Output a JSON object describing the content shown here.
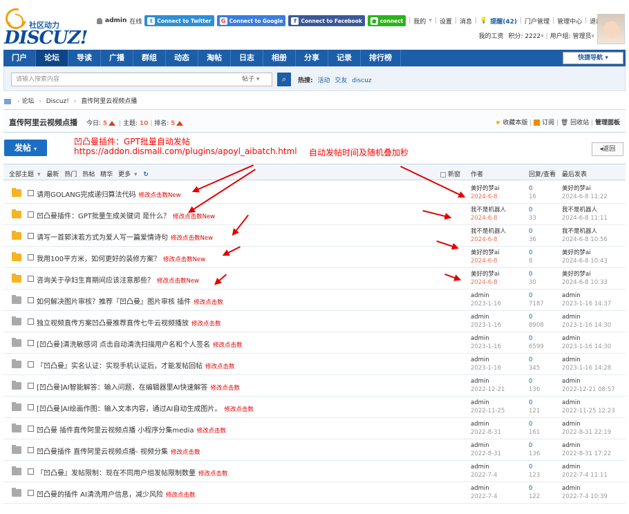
{
  "logo": {
    "sub": "社区动力",
    "main": "DISCUZ!"
  },
  "user": {
    "name": "admin",
    "status": "在线",
    "twitter": "Connect to Twitter",
    "google": "Connect to Google",
    "facebook": "Connect to Facebook",
    "wechat": "connect",
    "mine": "我的",
    "settings": "设置",
    "messages": "消息",
    "remind": "提醒(42)",
    "portal_admin": "门户管理",
    "admin_center": "管理中心",
    "logout": "退出",
    "salary": "我的工资",
    "credits": "积分: 2222",
    "group": "用户组: 管理员"
  },
  "nav": {
    "items": [
      "门户",
      "论坛",
      "导读",
      "广播",
      "群组",
      "动态",
      "淘帖",
      "日志",
      "相册",
      "分享",
      "记录",
      "排行榜"
    ],
    "active_index": 1,
    "quick": "快捷导航"
  },
  "search": {
    "placeholder": "请输入搜索内容",
    "type": "帖子",
    "hot_label": "热搜:",
    "hot_words": [
      "活动",
      "交友",
      "discuz"
    ]
  },
  "breadcrumb": [
    "论坛",
    "Discuz!",
    "直传阿里云视频点播"
  ],
  "forum": {
    "title": "直传阿里云视频点播",
    "today_label": "今日:",
    "today": "5",
    "topics_label": "主题:",
    "topics": "10",
    "rank_label": "排名:",
    "rank": "5",
    "fav": "收藏本版",
    "subscribe": "订阅",
    "recycle": "回收站",
    "manage": "管理面板"
  },
  "post_button": "发帖",
  "back_button": "返回",
  "annotations": {
    "line1": "凹凸曼插件：GPT批量自动发帖",
    "line2": "https://addon.dismall.com/plugins/apoyl_aibatch.html",
    "line3": "自动发帖时间及随机叠加秒"
  },
  "table": {
    "tabs": [
      "全部主题",
      "最新",
      "热门",
      "热帖",
      "精华",
      "更多"
    ],
    "new_window": "新窗",
    "col_author": "作者",
    "col_replies": "回复/查看",
    "col_last": "最后发表",
    "edit_label": "修改点击数",
    "new_label": "New",
    "rows": [
      {
        "title": "请用GOLANG完成递归算法代码",
        "author": "美好的梦ai",
        "date": "2024-6-8",
        "replies": "0",
        "views": "16",
        "last_user": "美好的梦ai",
        "last_time": "2024-6-8 11:22",
        "is_new": true
      },
      {
        "title": "凹凸曼插件：GPT批量生成关键词 是什么？",
        "author": "我不是机器人",
        "date": "2024-6-8",
        "replies": "0",
        "views": "33",
        "last_user": "我不是机器人",
        "last_time": "2024-6-8 11:11",
        "is_new": true
      },
      {
        "title": "请写一首郭沫若方式为爱人写一篇爱情诗句",
        "author": "我不是机器人",
        "date": "2024-6-8",
        "replies": "0",
        "views": "36",
        "last_user": "我不是机器人",
        "last_time": "2024-6-8 10:56",
        "is_new": true
      },
      {
        "title": "我用100平方米，如何更好的装修方案？",
        "author": "美好的梦ai",
        "date": "2024-6-8",
        "replies": "0",
        "views": "8",
        "last_user": "美好的梦ai",
        "last_time": "2024-6-8 10:43",
        "is_new": true
      },
      {
        "title": "咨询关于孕妇生育期间应该注意那些？",
        "author": "美好的梦ai",
        "date": "2024-6-8",
        "replies": "0",
        "views": "30",
        "last_user": "美好的梦ai",
        "last_time": "2024-6-8 10:33",
        "is_new": true
      },
      {
        "title": "如何解决图片审核？推荐『凹凸曼』图片审核 插件",
        "author": "admin",
        "date": "2023-1-16",
        "replies": "0",
        "views": "7187",
        "last_user": "admin",
        "last_time": "2023-1-16 14:37",
        "is_new": false
      },
      {
        "title": "独立视频直传方案凹凸曼推荐直传七牛云视频播放",
        "author": "admin",
        "date": "2023-1-16",
        "replies": "0",
        "views": "8908",
        "last_user": "admin",
        "last_time": "2023-1-16 14:30",
        "is_new": false
      },
      {
        "title": "[凹凸曼]清洗敏感词 点击自动清洗扫描用户名和个人签名",
        "author": "admin",
        "date": "2023-1-16",
        "replies": "0",
        "views": "6599",
        "last_user": "admin",
        "last_time": "2023-1-16 14:30",
        "is_new": false
      },
      {
        "title": "『凹凸曼』实名认证：实现手机认证后，才能发帖回帖",
        "author": "admin",
        "date": "2023-1-16",
        "replies": "0",
        "views": "345",
        "last_user": "admin",
        "last_time": "2023-1-16 14:28",
        "is_new": false
      },
      {
        "title": "[凹凸曼]AI智能解答：输入问题，在编辑器里AI快速解答",
        "author": "admin",
        "date": "2022-12-21",
        "replies": "0",
        "views": "136",
        "last_user": "admin",
        "last_time": "2022-12-21 08:57",
        "is_new": false
      },
      {
        "title": "[凹凸曼]AI绘画作图：输入文本内容，通过AI自动生成图片。",
        "author": "admin",
        "date": "2022-11-25",
        "replies": "0",
        "views": "121",
        "last_user": "admin",
        "last_time": "2022-11-25 12:23",
        "is_new": false
      },
      {
        "title": "凹凸曼 插件直传阿里云视频点播 小程序分集media",
        "author": "admin",
        "date": "2022-8-31",
        "replies": "0",
        "views": "161",
        "last_user": "admin",
        "last_time": "2022-8-31 22:19",
        "is_new": false
      },
      {
        "title": "凹凸曼插件 直传阿里云视频点播- 视频分集",
        "author": "admin",
        "date": "2022-8-31",
        "replies": "0",
        "views": "136",
        "last_user": "admin",
        "last_time": "2022-8-31 17:22",
        "is_new": false
      },
      {
        "title": "『凹凸曼』发帖限制：现在不同用户组发帖限制数量",
        "author": "admin",
        "date": "2022-7-4",
        "replies": "0",
        "views": "123",
        "last_user": "admin",
        "last_time": "2022-7-4 11:11",
        "is_new": false
      },
      {
        "title": "凹凸曼的插件 AI清洗用户信息，减少风险",
        "author": "admin",
        "date": "2022-7-4",
        "replies": "0",
        "views": "122",
        "last_user": "admin",
        "last_time": "2022-7-4 10:39",
        "is_new": false
      }
    ]
  }
}
